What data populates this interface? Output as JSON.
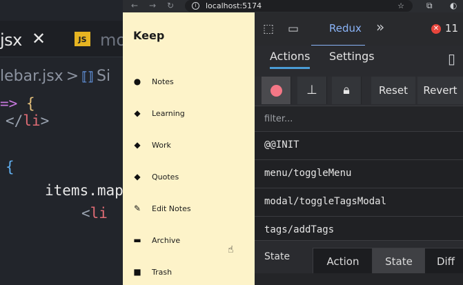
{
  "editor": {
    "tab_file": "jsx",
    "tab_close": "✕",
    "tab2_badge": "JS",
    "tab2_name": "mo",
    "breadcrumb_file": "lebar.jsx",
    "breadcrumb_sep": ">",
    "breadcrumb_symbol": "Si",
    "code": [
      {
        "a": "=>",
        "b": "{"
      },
      {
        "a": "</",
        "b": "li",
        "c": ">"
      },
      {
        "a": "{"
      },
      {
        "a": "items.map"
      },
      {
        "a": "<",
        "b": "li"
      }
    ]
  },
  "browser": {
    "url": "localhost:5174"
  },
  "keep": {
    "title": "Keep",
    "items": [
      {
        "label": "Notes",
        "icon": "lightbulb-icon"
      },
      {
        "label": "Learning",
        "icon": "tag-icon"
      },
      {
        "label": "Work",
        "icon": "tag-icon"
      },
      {
        "label": "Quotes",
        "icon": "tag-icon"
      },
      {
        "label": "Edit Notes",
        "icon": "pencil-icon"
      },
      {
        "label": "Archive",
        "icon": "archive-icon"
      },
      {
        "label": "Trash",
        "icon": "trash-icon"
      }
    ]
  },
  "devtools": {
    "panel_tab": "Redux",
    "more": "»",
    "error_count": "11",
    "sub_tabs": [
      "Actions",
      "Settings"
    ],
    "buttons": {
      "reset": "Reset",
      "revert": "Revert"
    },
    "filter_placeholder": "filter...",
    "actions": [
      "@@INIT",
      "menu/toggleMenu",
      "modal/toggleTagsModal",
      "tags/addTags"
    ],
    "state_label": "State",
    "view_tabs": [
      "Action",
      "State",
      "Diff"
    ],
    "active_view": "State"
  }
}
